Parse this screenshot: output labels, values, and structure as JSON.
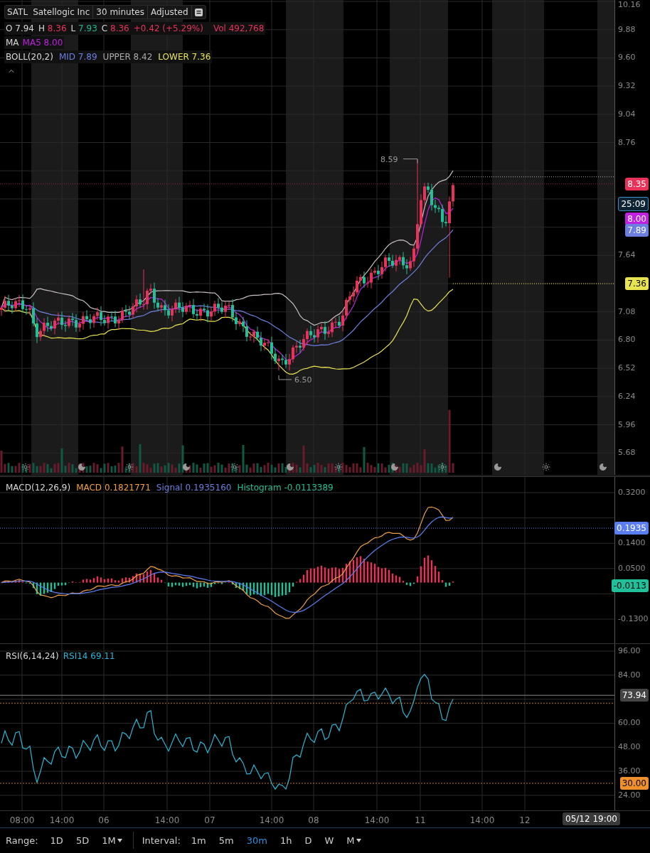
{
  "symbol_bar": {
    "symbol": "SATL",
    "name": "Satellogic Inc",
    "interval": "30 minutes",
    "adjustment": "Adjusted"
  },
  "ohlc": [
    {
      "label": "O",
      "value": "7.94",
      "kind": "neutral"
    },
    {
      "label": "H",
      "value": "8.36",
      "kind": "up"
    },
    {
      "label": "L",
      "value": "7.93",
      "kind": "down"
    },
    {
      "label": "C",
      "value": "8.36",
      "kind": "up"
    }
  ],
  "change": "+0.42 (+5.29%)",
  "volume": {
    "label": "Vol",
    "value": "492,768"
  },
  "ma": {
    "label": "MA",
    "value": "MA5 8.00"
  },
  "boll": {
    "label": "BOLL(20,2)",
    "mid": "MID 7.89",
    "upper": "UPPER 8.42",
    "lower": "LOWER 7.36"
  },
  "price_axis": {
    "ticks": [
      "10.16",
      "9.88",
      "9.60",
      "9.32",
      "9.04",
      "8.76",
      "7.64",
      "7.08",
      "6.80",
      "6.52",
      "6.24",
      "5.96",
      "5.68"
    ],
    "badges": [
      {
        "text": "8.35",
        "kind": "last"
      },
      {
        "text": "25:09",
        "kind": "countdown"
      },
      {
        "text": "8.00",
        "kind": "ma"
      },
      {
        "text": "7.89",
        "kind": "mid"
      },
      {
        "text": "7.36",
        "kind": "lower"
      }
    ]
  },
  "price_annotations": [
    {
      "text": "8.59",
      "kind": "high"
    },
    {
      "text": "6.50",
      "kind": "low"
    }
  ],
  "macd": {
    "label": "MACD(12,26,9)",
    "macd": "MACD 0.1821771",
    "signal": "Signal 0.1935160",
    "histogram": "Histogram -0.0113389",
    "ticks": [
      "0.3200",
      "0.1400",
      "0.0500",
      "-0.1300"
    ],
    "badges": [
      {
        "text": "0.1935",
        "kind": "signal"
      },
      {
        "text": "-0.0113",
        "kind": "histogram"
      }
    ]
  },
  "rsi": {
    "label": "RSI(6,14,24)",
    "value": "RSI14 69.11",
    "ticks": [
      "96.00",
      "84.00",
      "60.00",
      "48.00",
      "36.00",
      "24.00"
    ],
    "badges": [
      {
        "text": "73.94",
        "kind": "current"
      },
      {
        "text": "30.00",
        "kind": "oversold"
      }
    ]
  },
  "time_axis": {
    "labels": [
      "08:00",
      "14:00",
      "06",
      "14:00",
      "07",
      "14:00",
      "08",
      "14:00",
      "11",
      "14:00",
      "12"
    ],
    "cursor": "05/12 19:00"
  },
  "toolbar": {
    "range_label": "Range:",
    "ranges": [
      {
        "label": "1D",
        "selected": false,
        "menu": false
      },
      {
        "label": "5D",
        "selected": false,
        "menu": false
      },
      {
        "label": "1M",
        "selected": false,
        "menu": true
      }
    ],
    "interval_label": "Interval:",
    "intervals": [
      {
        "label": "1m",
        "selected": false,
        "menu": false
      },
      {
        "label": "5m",
        "selected": false,
        "menu": false
      },
      {
        "label": "30m",
        "selected": true,
        "menu": false
      },
      {
        "label": "1h",
        "selected": false,
        "menu": false
      },
      {
        "label": "D",
        "selected": false,
        "menu": false
      },
      {
        "label": "W",
        "selected": false,
        "menu": false
      },
      {
        "label": "M",
        "selected": false,
        "menu": true
      }
    ]
  }
}
